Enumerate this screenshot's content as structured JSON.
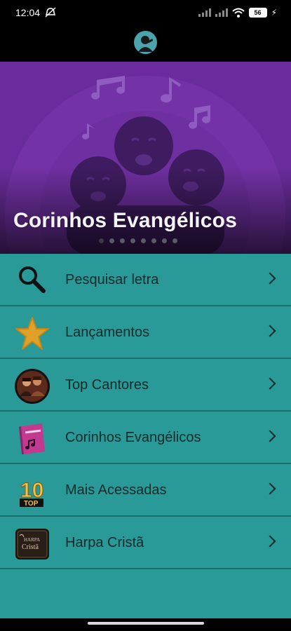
{
  "status": {
    "time": "12:04",
    "battery": "56"
  },
  "banner": {
    "title": "Corinhos Evangélicos",
    "page_count": 8,
    "active_index": 0
  },
  "menu": {
    "items": [
      {
        "label": "Pesquisar letra",
        "icon": "magnifier-icon"
      },
      {
        "label": "Lançamentos",
        "icon": "star-icon"
      },
      {
        "label": "Top Cantores",
        "icon": "singers-photo-icon"
      },
      {
        "label": "Corinhos Evangélicos",
        "icon": "songbook-icon"
      },
      {
        "label": "Mais Acessadas",
        "icon": "top-10-icon"
      },
      {
        "label": "Harpa Cristã",
        "icon": "harpa-book-icon"
      }
    ]
  },
  "icon_texts": {
    "top10_number": "10",
    "top10_word": "TOP",
    "harpa_line1": "HARPA",
    "harpa_line2": "Cristã"
  },
  "colors": {
    "banner": "#6a2c9c",
    "menu": "#2a9a98",
    "divider": "#1d6d6b",
    "app_bar": "#000000"
  }
}
